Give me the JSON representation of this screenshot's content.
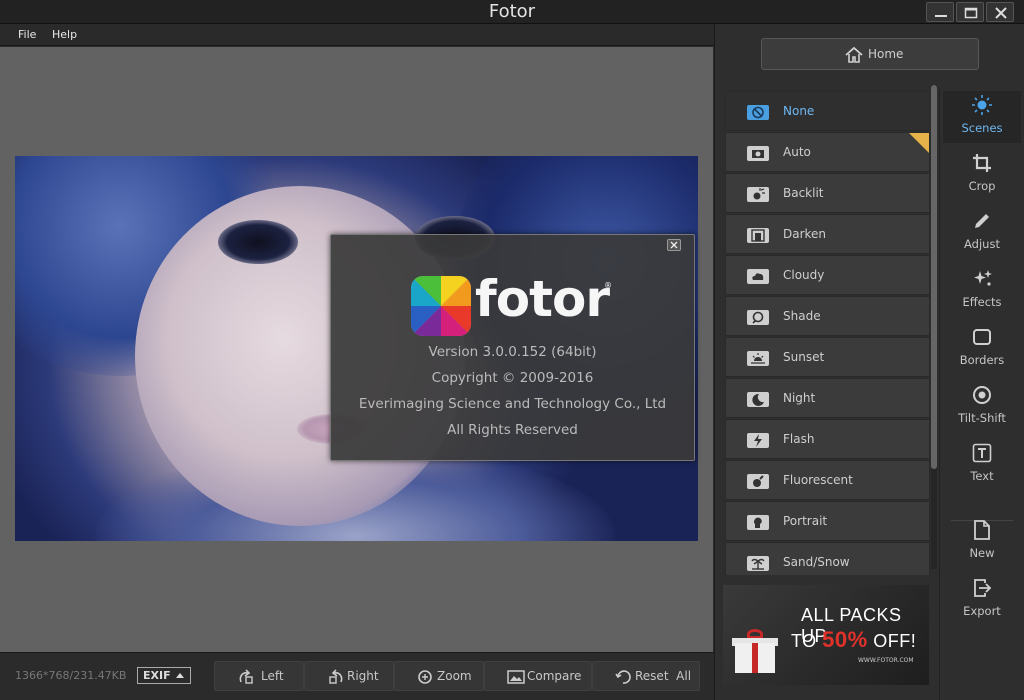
{
  "window": {
    "title": "Fotor",
    "controls": [
      "minimize",
      "maximize",
      "close"
    ]
  },
  "menu": {
    "items": [
      "File",
      "Help"
    ]
  },
  "about": {
    "logo_text": "fotor",
    "logo_reg": "®",
    "version": "Version   3.0.0.152  (64bit)",
    "copyright": "Copyright © 2009-2016",
    "company": "Everimaging Science and Technology Co., Ltd",
    "rights": "All Rights Reserved"
  },
  "bottom": {
    "image_info": "1366*768/231.47KB",
    "exif": "EXIF",
    "buttons": [
      "Left",
      "Right",
      "Zoom",
      "Compare",
      "Reset  All"
    ]
  },
  "panel": {
    "home": "Home",
    "scenes": [
      {
        "label": "None",
        "icon": "none-icon",
        "active": true
      },
      {
        "label": "Auto",
        "icon": "camera-icon"
      },
      {
        "label": "Backlit",
        "icon": "backlit-icon"
      },
      {
        "label": "Darken",
        "icon": "darken-icon"
      },
      {
        "label": "Cloudy",
        "icon": "cloud-icon"
      },
      {
        "label": "Shade",
        "icon": "shade-icon"
      },
      {
        "label": "Sunset",
        "icon": "sunset-icon"
      },
      {
        "label": "Night",
        "icon": "moon-icon"
      },
      {
        "label": "Flash",
        "icon": "flash-icon"
      },
      {
        "label": "Fluorescent",
        "icon": "bulb-icon"
      },
      {
        "label": "Portrait",
        "icon": "portrait-icon"
      },
      {
        "label": "Sand/Snow",
        "icon": "palm-icon"
      }
    ],
    "ad": {
      "line1": "ALL PACKS UP",
      "line2_pre": "TO ",
      "line2_hot": "50%",
      "line2_post": " OFF!",
      "url": "WWW.FOTOR.COM"
    },
    "nav": [
      {
        "label": "Scenes",
        "icon": "sun-icon",
        "active": true
      },
      {
        "label": "Crop",
        "icon": "crop-icon"
      },
      {
        "label": "Adjust",
        "icon": "pencil-icon"
      },
      {
        "label": "Effects",
        "icon": "sparkle-icon"
      },
      {
        "label": "Borders",
        "icon": "border-icon"
      },
      {
        "label": "Tilt-Shift",
        "icon": "tiltshift-icon"
      },
      {
        "label": "Text",
        "icon": "text-icon"
      },
      {
        "label": "New",
        "icon": "new-file-icon"
      },
      {
        "label": "Export",
        "icon": "export-icon"
      }
    ]
  },
  "colors": {
    "accent": "#4a9fe0",
    "accent_text": "#6fb8f2",
    "badge": "#e6b34a",
    "ad_highlight": "#e0312b"
  }
}
